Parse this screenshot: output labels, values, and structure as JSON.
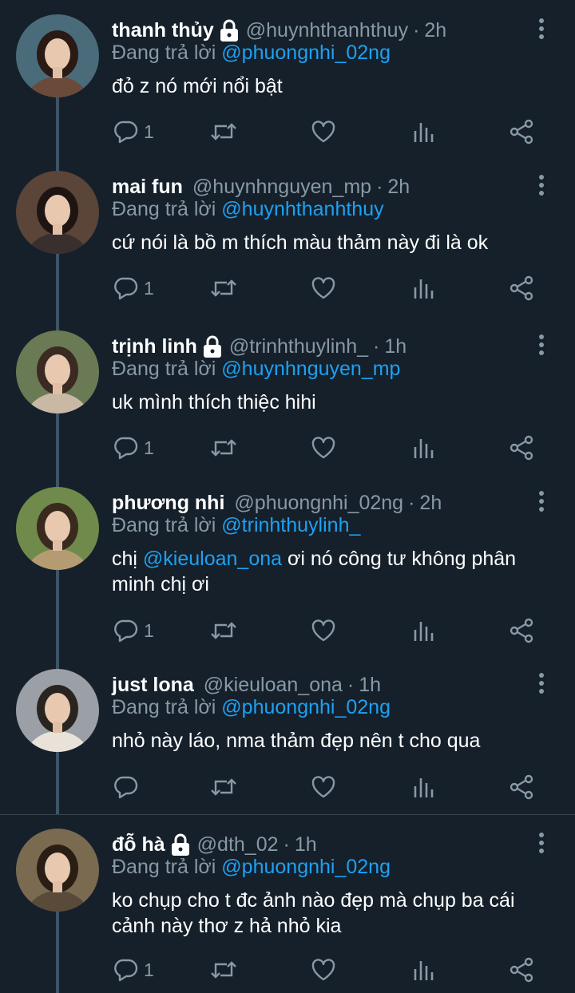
{
  "reply_prefix": "Đang trả lời",
  "colors": {
    "background": "#15202b",
    "mention": "#1da1f2",
    "muted": "#8899a6",
    "thread_line": "#3d5466"
  },
  "icons": {
    "reply": "reply-icon",
    "retweet": "retweet-icon",
    "like": "heart-icon",
    "analytics": "analytics-icon",
    "share": "share-icon",
    "lock": "lock-icon",
    "more": "more-vertical-icon"
  },
  "tweets": [
    {
      "name": "thanh thủy",
      "locked": true,
      "handle": "@huynhthanhthuy",
      "time": "2h",
      "reply_to": "@phuongnhi_02ng",
      "text_before": "đỏ z nó mới nổi bật",
      "text_mention": "",
      "text_after": "",
      "reply_count": "1"
    },
    {
      "name": "mai fun",
      "locked": false,
      "handle": "@huynhnguyen_mp",
      "time": "2h",
      "reply_to": "@huynhthanhthuy",
      "text_before": "cứ nói là bồ m thích màu thảm này đi là ok",
      "text_mention": "",
      "text_after": "",
      "reply_count": "1"
    },
    {
      "name": "trịnh linh",
      "locked": true,
      "handle": "@trinhthuylinh_",
      "time": "1h",
      "reply_to": "@huynhnguyen_mp",
      "text_before": "uk mình thích thiệc hihi",
      "text_mention": "",
      "text_after": "",
      "reply_count": "1"
    },
    {
      "name": "phương nhi",
      "locked": false,
      "handle": "@phuongnhi_02ng",
      "time": "2h",
      "reply_to": "@trinhthuylinh_",
      "text_before": "chị ",
      "text_mention": "@kieuloan_ona",
      "text_after": " ơi nó công tư không phân minh chị ơi",
      "reply_count": "1"
    },
    {
      "name": "just lona",
      "locked": false,
      "handle": "@kieuloan_ona",
      "time": "1h",
      "reply_to": "@phuongnhi_02ng",
      "text_before": "nhỏ này láo, nma thảm đẹp nên t cho qua",
      "text_mention": "",
      "text_after": "",
      "reply_count": ""
    },
    {
      "name": "đỗ hà",
      "locked": true,
      "handle": "@dth_02",
      "time": "1h",
      "reply_to": "@phuongnhi_02ng",
      "text_before": "ko chụp cho t đc ảnh nào đẹp mà chụp ba cái cảnh này thơ z hả nhỏ kia",
      "text_mention": "",
      "text_after": "",
      "reply_count": "1"
    }
  ]
}
